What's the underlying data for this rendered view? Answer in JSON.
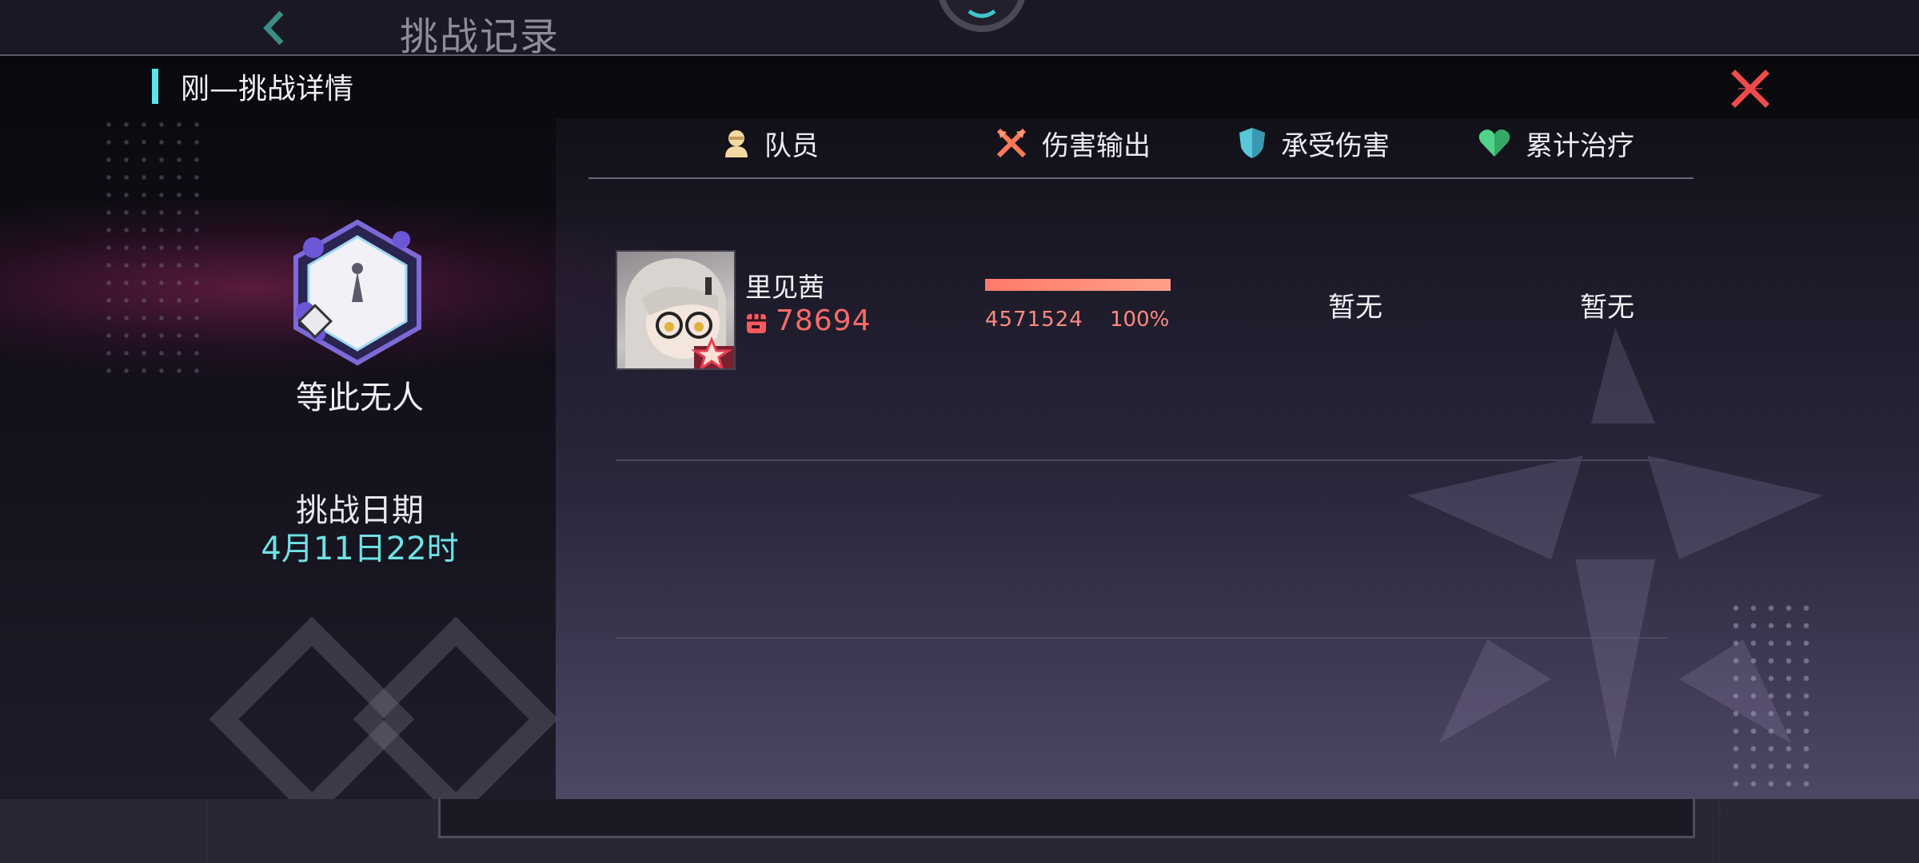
{
  "background_page": {
    "title": "挑战记录",
    "back_icon": "chevron-left-icon"
  },
  "modal": {
    "title": "刚—挑战详情",
    "close_icon": "close-x-icon",
    "accent_color": "#5fe3e8",
    "close_color": "#f04a4a"
  },
  "stage": {
    "name": "等此无人",
    "emblem_icon": "stage-emblem-icon",
    "date_label": "挑战日期",
    "date_value": "4月11日22时"
  },
  "columns": [
    {
      "label": "队员",
      "icon": "member-icon"
    },
    {
      "label": "伤害输出",
      "icon": "crossed-swords-icon"
    },
    {
      "label": "承受伤害",
      "icon": "shield-icon"
    },
    {
      "label": "累计治疗",
      "icon": "heart-icon"
    }
  ],
  "members": [
    {
      "name": "里见茜",
      "power": "78694",
      "damage": "4571524",
      "damage_percent": "100%",
      "damage_fraction": 1.0,
      "damage_taken": "暂无",
      "healing": "暂无"
    }
  ]
}
